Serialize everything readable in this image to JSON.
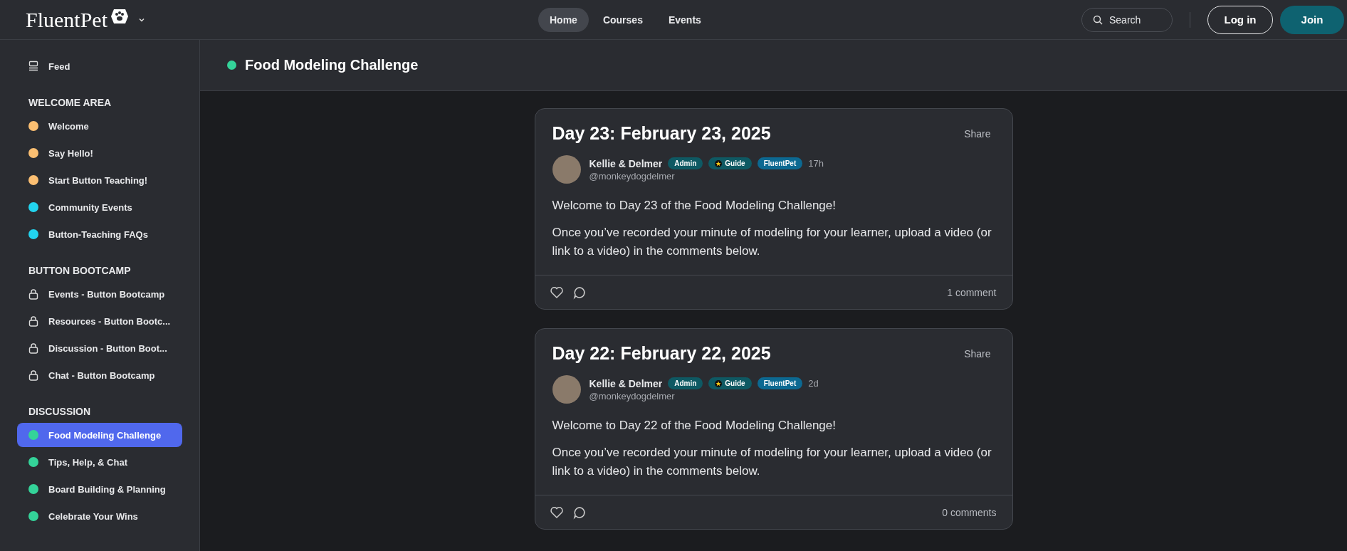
{
  "topbar": {
    "logo": "FluentPet",
    "nav": [
      {
        "label": "Home",
        "selected": true
      },
      {
        "label": "Courses",
        "selected": false
      },
      {
        "label": "Events",
        "selected": false
      }
    ],
    "search": {
      "placeholder": "Search"
    },
    "login": "Log in",
    "join": "Join"
  },
  "sidebar": {
    "items": [
      {
        "label": "Feed",
        "kind": "feed",
        "selected": false
      }
    ],
    "sections": [
      {
        "title": "WELCOME AREA",
        "items": [
          {
            "label": "Welcome",
            "kind": "dot",
            "color": "#fbbf72",
            "selected": false
          },
          {
            "label": "Say Hello!",
            "kind": "dot",
            "color": "#fbbf72",
            "selected": false
          },
          {
            "label": "Start Button Teaching!",
            "kind": "dot",
            "color": "#fbbf72",
            "selected": false
          },
          {
            "label": "Community Events",
            "kind": "dot",
            "color": "#22d3ee",
            "selected": false
          },
          {
            "label": "Button-Teaching FAQs",
            "kind": "dot",
            "color": "#22d3ee",
            "selected": false
          }
        ]
      },
      {
        "title": "BUTTON BOOTCAMP",
        "items": [
          {
            "label": "Events - Button Bootcamp",
            "kind": "lock",
            "selected": false
          },
          {
            "label": "Resources - Button Bootc...",
            "kind": "lock",
            "selected": false
          },
          {
            "label": "Discussion - Button Boot...",
            "kind": "lock",
            "selected": false
          },
          {
            "label": "Chat - Button Bootcamp",
            "kind": "lock",
            "selected": false
          }
        ]
      },
      {
        "title": "DISCUSSION",
        "items": [
          {
            "label": "Food Modeling Challenge",
            "kind": "dot",
            "color": "#34d399",
            "selected": true
          },
          {
            "label": "Tips, Help, & Chat",
            "kind": "dot",
            "color": "#34d399",
            "selected": false
          },
          {
            "label": "Board Building & Planning",
            "kind": "dot",
            "color": "#34d399",
            "selected": false
          },
          {
            "label": "Celebrate Your Wins",
            "kind": "dot",
            "color": "#34d399",
            "selected": false
          }
        ]
      }
    ]
  },
  "space": {
    "title": "Food Modeling Challenge",
    "color": "#34d399"
  },
  "posts": [
    {
      "title": "Day 23: February 23, 2025",
      "share": "Share",
      "author": "Kellie & Delmer",
      "badges": [
        {
          "label": "Admin",
          "kind": "admin"
        },
        {
          "label": "Guide",
          "kind": "guide"
        },
        {
          "label": "FluentPet",
          "kind": "brand"
        }
      ],
      "time": "17h",
      "handle": "@monkeydogdelmer",
      "paragraphs": [
        "Welcome to Day 23 of the Food Modeling Challenge!",
        "Once you’ve recorded your minute of modeling for your learner, upload a video (or link to a video) in the comments below."
      ],
      "comments": "1 comment"
    },
    {
      "title": "Day 22: February 22, 2025",
      "share": "Share",
      "author": "Kellie & Delmer",
      "badges": [
        {
          "label": "Admin",
          "kind": "admin"
        },
        {
          "label": "Guide",
          "kind": "guide"
        },
        {
          "label": "FluentPet",
          "kind": "brand"
        }
      ],
      "time": "2d",
      "handle": "@monkeydogdelmer",
      "paragraphs": [
        "Welcome to Day 22 of the Food Modeling Challenge!",
        "Once you’ve recorded your minute of modeling for your learner, upload a video (or link to a video) in the comments below."
      ],
      "comments": "0 comments"
    }
  ]
}
